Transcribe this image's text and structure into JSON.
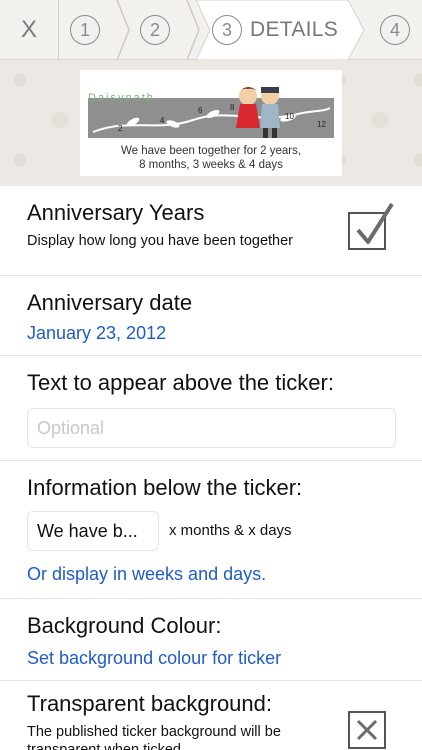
{
  "steps": {
    "close_label": "X",
    "step1": "1",
    "step2": "2",
    "step3": "3",
    "step3_label": "DETAILS",
    "step4": "4"
  },
  "banner": {
    "brand": "Daisypath",
    "ticker_numbers": [
      "2",
      "4",
      "6",
      "8",
      "10",
      "12"
    ],
    "ticker_text_line1": "We have been together for 2 years,",
    "ticker_text_line2": "8 months, 3 weeks & 4 days"
  },
  "anniversary_years": {
    "title": "Anniversary Years",
    "description": "Display how long you have been together",
    "checked": true
  },
  "anniversary_date": {
    "title": "Anniversary date",
    "value": "January 23, 2012"
  },
  "text_above": {
    "title": "Text to appear above the ticker:",
    "placeholder": "Optional"
  },
  "info_below": {
    "title": "Information below the ticker:",
    "field_value": "We have b...",
    "note": "x months & x days",
    "link": "Or display in weeks and days."
  },
  "background_colour": {
    "title": "Background Colour:",
    "link": "Set background colour for ticker"
  },
  "transparent_background": {
    "title": "Transparent background:",
    "description": "The published ticker background will be transparent when ticked",
    "checked": false
  }
}
